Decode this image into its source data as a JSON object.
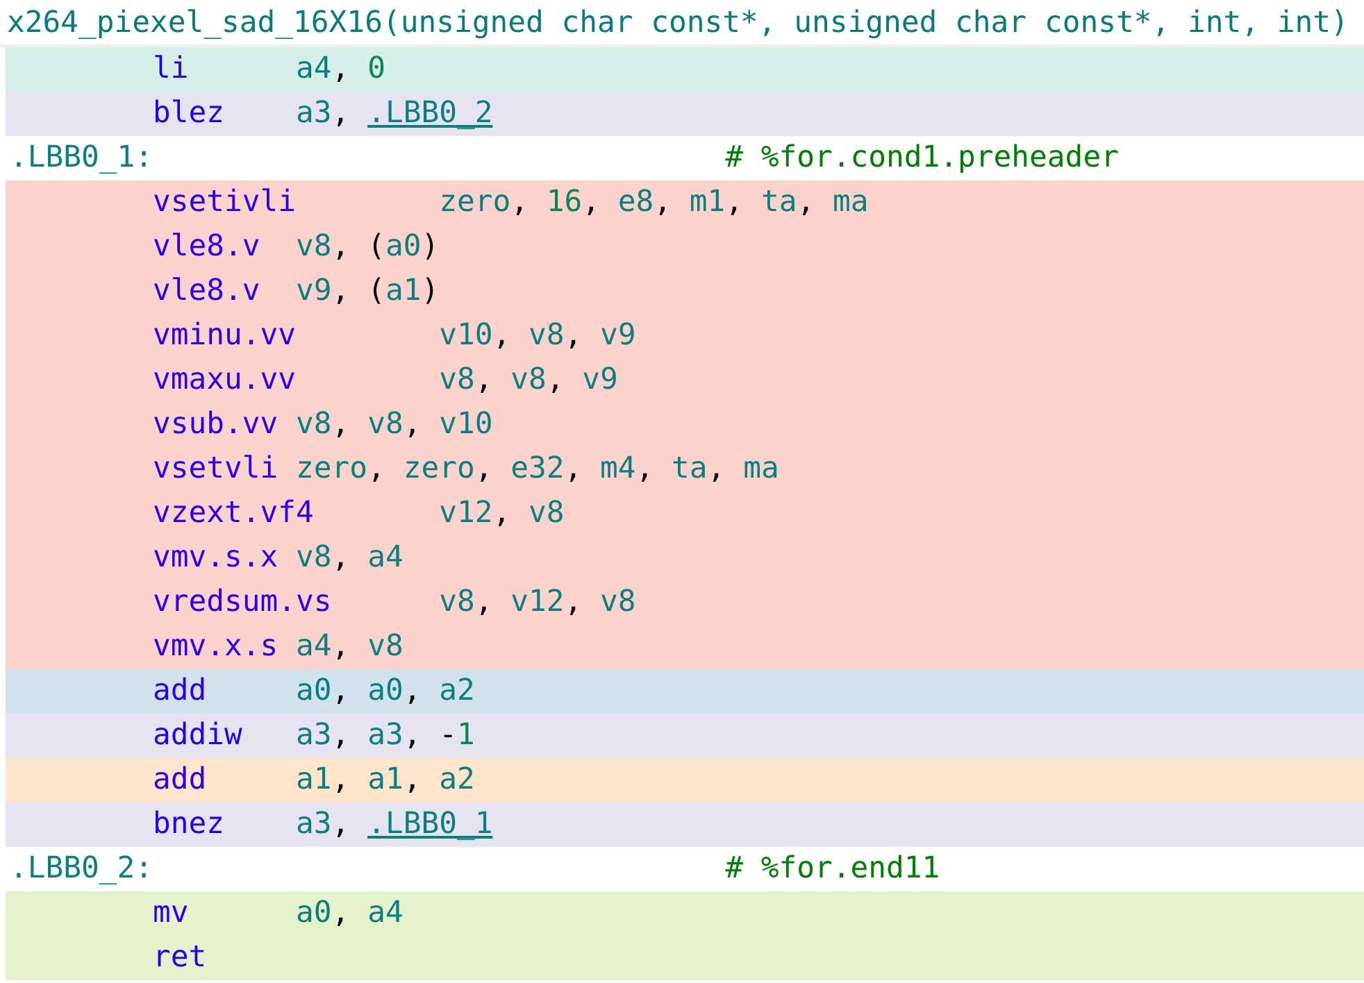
{
  "function_signature": "x264_piexel_sad_16X16(unsigned char const*, unsigned char const*, int, int)",
  "lines": [
    {
      "kind": "instruction",
      "color": "#d6efe9",
      "mnemonic": "li",
      "operands": [
        {
          "text": "a4",
          "kind": "reg"
        },
        {
          "text": ", ",
          "kind": "punct"
        },
        {
          "text": "0",
          "kind": "num"
        }
      ]
    },
    {
      "kind": "instruction",
      "color": "#e6e4f1",
      "mnemonic": "blez",
      "operands": [
        {
          "text": "a3",
          "kind": "reg"
        },
        {
          "text": ", ",
          "kind": "punct"
        },
        {
          "text": ".LBB0_2",
          "kind": "label"
        }
      ]
    },
    {
      "kind": "label",
      "label": ".LBB0_1:",
      "comment": "# %for.cond1.preheader"
    },
    {
      "kind": "instruction",
      "color": "#fcd3cd",
      "mnemonic": "vsetivli",
      "operands": [
        {
          "text": "zero",
          "kind": "reg"
        },
        {
          "text": ", ",
          "kind": "punct"
        },
        {
          "text": "16",
          "kind": "num"
        },
        {
          "text": ", ",
          "kind": "punct"
        },
        {
          "text": "e8",
          "kind": "reg"
        },
        {
          "text": ", ",
          "kind": "punct"
        },
        {
          "text": "m1",
          "kind": "reg"
        },
        {
          "text": ", ",
          "kind": "punct"
        },
        {
          "text": "ta",
          "kind": "reg"
        },
        {
          "text": ", ",
          "kind": "punct"
        },
        {
          "text": "ma",
          "kind": "reg"
        }
      ]
    },
    {
      "kind": "instruction",
      "color": "#fcd3cd",
      "mnemonic": "vle8.v",
      "operands": [
        {
          "text": "v8",
          "kind": "reg"
        },
        {
          "text": ", (",
          "kind": "punct"
        },
        {
          "text": "a0",
          "kind": "reg"
        },
        {
          "text": ")",
          "kind": "punct"
        }
      ]
    },
    {
      "kind": "instruction",
      "color": "#fcd3cd",
      "mnemonic": "vle8.v",
      "operands": [
        {
          "text": "v9",
          "kind": "reg"
        },
        {
          "text": ", (",
          "kind": "punct"
        },
        {
          "text": "a1",
          "kind": "reg"
        },
        {
          "text": ")",
          "kind": "punct"
        }
      ]
    },
    {
      "kind": "instruction",
      "color": "#fcd3cd",
      "mnemonic": "vminu.vv",
      "operands": [
        {
          "text": "v10",
          "kind": "reg"
        },
        {
          "text": ", ",
          "kind": "punct"
        },
        {
          "text": "v8",
          "kind": "reg"
        },
        {
          "text": ", ",
          "kind": "punct"
        },
        {
          "text": "v9",
          "kind": "reg"
        }
      ]
    },
    {
      "kind": "instruction",
      "color": "#fcd3cd",
      "mnemonic": "vmaxu.vv",
      "operands": [
        {
          "text": "v8",
          "kind": "reg"
        },
        {
          "text": ", ",
          "kind": "punct"
        },
        {
          "text": "v8",
          "kind": "reg"
        },
        {
          "text": ", ",
          "kind": "punct"
        },
        {
          "text": "v9",
          "kind": "reg"
        }
      ]
    },
    {
      "kind": "instruction",
      "color": "#fcd3cd",
      "mnemonic": "vsub.vv",
      "operands": [
        {
          "text": "v8",
          "kind": "reg"
        },
        {
          "text": ", ",
          "kind": "punct"
        },
        {
          "text": "v8",
          "kind": "reg"
        },
        {
          "text": ", ",
          "kind": "punct"
        },
        {
          "text": "v10",
          "kind": "reg"
        }
      ]
    },
    {
      "kind": "instruction",
      "color": "#fcd3cd",
      "mnemonic": "vsetvli",
      "operands": [
        {
          "text": "zero",
          "kind": "reg"
        },
        {
          "text": ", ",
          "kind": "punct"
        },
        {
          "text": "zero",
          "kind": "reg"
        },
        {
          "text": ", ",
          "kind": "punct"
        },
        {
          "text": "e32",
          "kind": "reg"
        },
        {
          "text": ", ",
          "kind": "punct"
        },
        {
          "text": "m4",
          "kind": "reg"
        },
        {
          "text": ", ",
          "kind": "punct"
        },
        {
          "text": "ta",
          "kind": "reg"
        },
        {
          "text": ", ",
          "kind": "punct"
        },
        {
          "text": "ma",
          "kind": "reg"
        }
      ]
    },
    {
      "kind": "instruction",
      "color": "#fcd3cd",
      "mnemonic": "vzext.vf4",
      "operands": [
        {
          "text": "v12",
          "kind": "reg"
        },
        {
          "text": ", ",
          "kind": "punct"
        },
        {
          "text": "v8",
          "kind": "reg"
        }
      ]
    },
    {
      "kind": "instruction",
      "color": "#fcd3cd",
      "mnemonic": "vmv.s.x",
      "operands": [
        {
          "text": "v8",
          "kind": "reg"
        },
        {
          "text": ", ",
          "kind": "punct"
        },
        {
          "text": "a4",
          "kind": "reg"
        }
      ]
    },
    {
      "kind": "instruction",
      "color": "#fcd3cd",
      "mnemonic": "vredsum.vs",
      "operands": [
        {
          "text": "v8",
          "kind": "reg"
        },
        {
          "text": ", ",
          "kind": "punct"
        },
        {
          "text": "v12",
          "kind": "reg"
        },
        {
          "text": ", ",
          "kind": "punct"
        },
        {
          "text": "v8",
          "kind": "reg"
        }
      ]
    },
    {
      "kind": "instruction",
      "color": "#fcd3cd",
      "mnemonic": "vmv.x.s",
      "operands": [
        {
          "text": "a4",
          "kind": "reg"
        },
        {
          "text": ", ",
          "kind": "punct"
        },
        {
          "text": "v8",
          "kind": "reg"
        }
      ]
    },
    {
      "kind": "instruction",
      "color": "#d3e3ee",
      "mnemonic": "add",
      "operands": [
        {
          "text": "a0",
          "kind": "reg"
        },
        {
          "text": ", ",
          "kind": "punct"
        },
        {
          "text": "a0",
          "kind": "reg"
        },
        {
          "text": ", ",
          "kind": "punct"
        },
        {
          "text": "a2",
          "kind": "reg"
        }
      ]
    },
    {
      "kind": "instruction",
      "color": "#e6e4f1",
      "mnemonic": "addiw",
      "operands": [
        {
          "text": "a3",
          "kind": "reg"
        },
        {
          "text": ", ",
          "kind": "punct"
        },
        {
          "text": "a3",
          "kind": "reg"
        },
        {
          "text": ", -",
          "kind": "punct"
        },
        {
          "text": "1",
          "kind": "num"
        }
      ]
    },
    {
      "kind": "instruction",
      "color": "#fde4cb",
      "mnemonic": "add",
      "operands": [
        {
          "text": "a1",
          "kind": "reg"
        },
        {
          "text": ", ",
          "kind": "punct"
        },
        {
          "text": "a1",
          "kind": "reg"
        },
        {
          "text": ", ",
          "kind": "punct"
        },
        {
          "text": "a2",
          "kind": "reg"
        }
      ]
    },
    {
      "kind": "instruction",
      "color": "#e6e4f1",
      "mnemonic": "bnez",
      "operands": [
        {
          "text": "a3",
          "kind": "reg"
        },
        {
          "text": ", ",
          "kind": "punct"
        },
        {
          "text": ".LBB0_1",
          "kind": "label"
        }
      ]
    },
    {
      "kind": "label",
      "label": ".LBB0_2:",
      "comment": "# %for.end11"
    },
    {
      "kind": "instruction",
      "color": "#e3f2cb",
      "mnemonic": "mv",
      "operands": [
        {
          "text": "a0",
          "kind": "reg"
        },
        {
          "text": ", ",
          "kind": "punct"
        },
        {
          "text": "a4",
          "kind": "reg"
        }
      ]
    },
    {
      "kind": "instruction",
      "color": "#e3f2cb",
      "mnemonic": "ret"
    }
  ]
}
